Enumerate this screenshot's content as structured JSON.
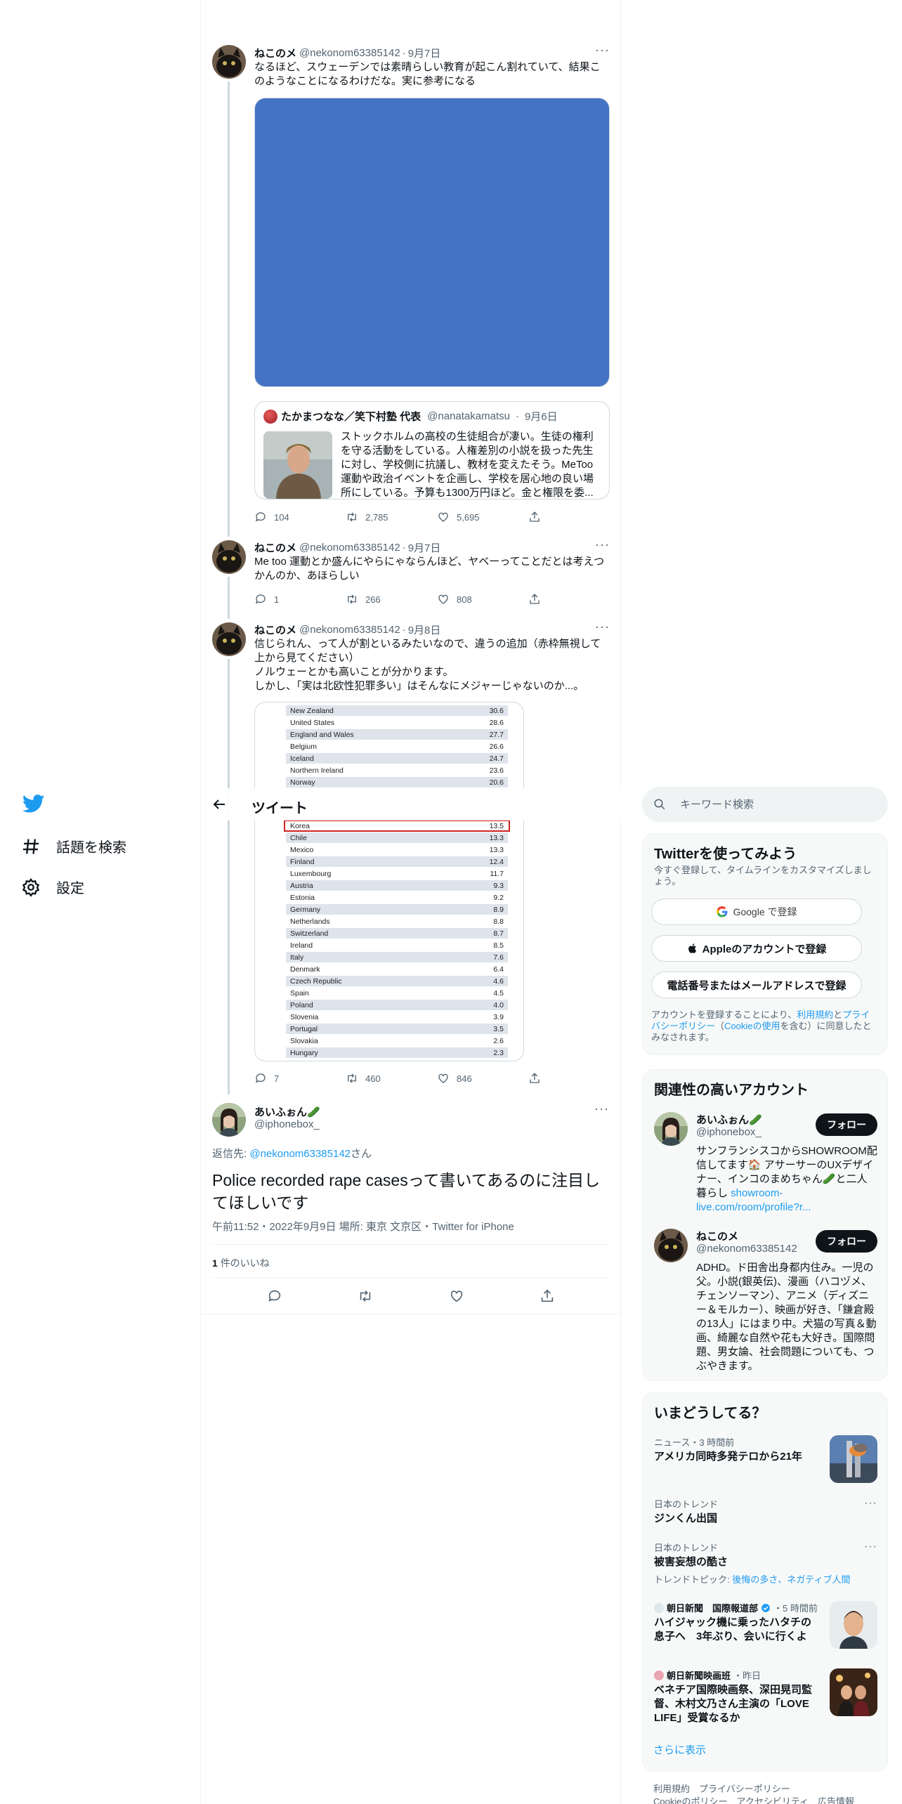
{
  "nav": {
    "items": [
      {
        "label": "話題を検索",
        "icon": "hashtag-icon"
      },
      {
        "label": "設定",
        "icon": "gear-icon"
      }
    ]
  },
  "header": {
    "title": "ツイート"
  },
  "thread": [
    {
      "name": "ねこのメ",
      "handle": "@nekonom63385142",
      "date": "9月7日",
      "text": "なるほど、スウェーデンでは素晴らしい教育が起こん割れていて、結果このようなことになるわけだな。実に参考になる",
      "quote": {
        "name": "たかまつなな／笑下村塾 代表",
        "handle": "@nanatakamatsu",
        "date": "9月6日",
        "text": "ストックホルムの高校の生徒組合が凄い。生徒の権利を守る活動をしている。人権差別の小説を扱った先生に対し、学校側に抗議し、教材を変えたそう。MeToo運動や政治イベントを企画し、学校を居心地の良い場所にしている。予算も1300万円ほど。金と権限を委..."
      },
      "replies": "104",
      "retweets": "2,785",
      "likes": "5,695"
    },
    {
      "name": "ねこのメ",
      "handle": "@nekonom63385142",
      "date": "9月7日",
      "text": "Me too 運動とか盛んにやらにゃならんほど、ヤベーってことだとは考えつかんのか、あほらしい",
      "replies": "1",
      "retweets": "266",
      "likes": "808"
    },
    {
      "name": "ねこのメ",
      "handle": "@nekonom63385142",
      "date": "9月8日",
      "text": "信じられん、って人が割といるみたいなので、違うの追加（赤枠無視して上から見てください）\nノルウェーとかも高いことが分かります。\nしかし、「実は北欧性犯罪多い」はそんなにメジャーじゃないのか...。",
      "replies": "7",
      "retweets": "460",
      "likes": "846"
    }
  ],
  "table_rows": [
    {
      "country": "New Zealand",
      "value": "30.6"
    },
    {
      "country": "United States",
      "value": "28.6"
    },
    {
      "country": "England and Wales",
      "value": "27.7"
    },
    {
      "country": "Belgium",
      "value": "26.6"
    },
    {
      "country": "Iceland",
      "value": "24.7"
    },
    {
      "country": "Northern Ireland",
      "value": "23.6"
    },
    {
      "country": "Norway",
      "value": "20.6"
    },
    {
      "country": "Korea",
      "value": "13.5"
    },
    {
      "country": "Chile",
      "value": "13.3"
    },
    {
      "country": "Mexico",
      "value": "13.3"
    },
    {
      "country": "Finland",
      "value": "12.4"
    },
    {
      "country": "Luxembourg",
      "value": "11.7"
    },
    {
      "country": "Austria",
      "value": "9.3"
    },
    {
      "country": "Estonia",
      "value": "9.2"
    },
    {
      "country": "Germany",
      "value": "8.9"
    },
    {
      "country": "Netherlands",
      "value": "8.8"
    },
    {
      "country": "Switzerland",
      "value": "8.7"
    },
    {
      "country": "Ireland",
      "value": "8.5"
    },
    {
      "country": "Italy",
      "value": "7.6"
    },
    {
      "country": "Denmark",
      "value": "6.4"
    },
    {
      "country": "Czech Republic",
      "value": "4.6"
    },
    {
      "country": "Spain",
      "value": "4.5"
    },
    {
      "country": "Poland",
      "value": "4.0"
    },
    {
      "country": "Slovenia",
      "value": "3.9"
    },
    {
      "country": "Portugal",
      "value": "3.5"
    },
    {
      "country": "Slovakia",
      "value": "2.6"
    },
    {
      "country": "Hungary",
      "value": "2.3"
    }
  ],
  "main_tweet": {
    "name": "あいふぉん🥒",
    "handle": "@iphonebox_",
    "reply_prefix": "返信先: ",
    "reply_link": "@nekonom63385142",
    "reply_suffix": "さん",
    "text": "Police recorded rape casesって書いてあるのに注目してほしいです",
    "meta": "午前11:52・2022年9月9日 場所: 東京 文京区・Twitter for iPhone",
    "likes_count": "1",
    "likes_label": "件のいいね"
  },
  "search": {
    "placeholder": "キーワード検索"
  },
  "signup": {
    "title": "Twitterを使ってみよう",
    "subtitle": "今すぐ登録して、タイムラインをカスタマイズしましょう。",
    "google": "Google で登録",
    "apple": "Appleのアカウントで登録",
    "phone": "電話番号またはメールアドレスで登録",
    "terms_pre": "アカウントを登録することにより、",
    "terms_link1": "利用規約",
    "terms_mid1": "と",
    "terms_link2": "プライバシーポリシー",
    "terms_mid2": "（",
    "terms_link3": "Cookieの使用",
    "terms_post": "を含む）に同意したとみなされます。"
  },
  "related": {
    "title": "関連性の高いアカウント",
    "accounts": [
      {
        "name": "あいふぉん🥒",
        "handle": "@iphonebox_",
        "follow": "フォロー",
        "bio": "サンフランシスコからSHOWROOM配信してます🏠 アサーサーのUXデザイナー、インコのまめちゃん🥒と二人暮らし ",
        "bio_link": "showroom-live.com/room/profile?r..."
      },
      {
        "name": "ねこのメ",
        "handle": "@nekonom63385142",
        "follow": "フォロー",
        "bio": "ADHD。ド田舎出身都内住み。一児の父。小説(銀英伝)、漫画（ハコヅメ、チェンソーマン）、アニメ（ディズニー＆モルカー）、映画が好き、「鎌倉殿の13人」にはまり中。犬猫の写真＆動画、綺麗な自然や花も大好き。国際問題、男女論、社会問題についても、つぶやきます。",
        "bio_link": ""
      }
    ]
  },
  "trends": {
    "title": "いまどうしてる？",
    "items": [
      {
        "meta": "ニュース・3 時間前",
        "title": "アメリカ同時多発テロから21年"
      },
      {
        "meta": "日本のトレンド",
        "title": "ジンくん出国"
      },
      {
        "meta": "日本のトレンド",
        "title": "被害妄想の酷さ",
        "topic_label": "トレンドトピック: ",
        "topic_links": "後悔の多さ、ネガティブ人間"
      },
      {
        "source": "朝日新聞　国際報道部",
        "time": "・5 時間前",
        "title": "ハイジャック機に乗ったハタチの息子へ　3年ぶり、会いに行くよ"
      },
      {
        "source": "朝日新聞映画班",
        "time": "・昨日",
        "title": "ベネチア国際映画祭、深田晃司監督、木村文乃さん主演の「LOVE LIFE」受賞なるか"
      }
    ],
    "show_more": "さらに表示"
  },
  "footer": {
    "line1": "利用規約　プライバシーポリシー",
    "line2": "Cookieのポリシー　アクセシビリティ　広告情報"
  },
  "colors": {
    "accent": "#1d9bf0",
    "text": "#0f1419",
    "muted": "#536471",
    "quote_media": "#4472c4",
    "highlight_box": "#cc2222"
  }
}
